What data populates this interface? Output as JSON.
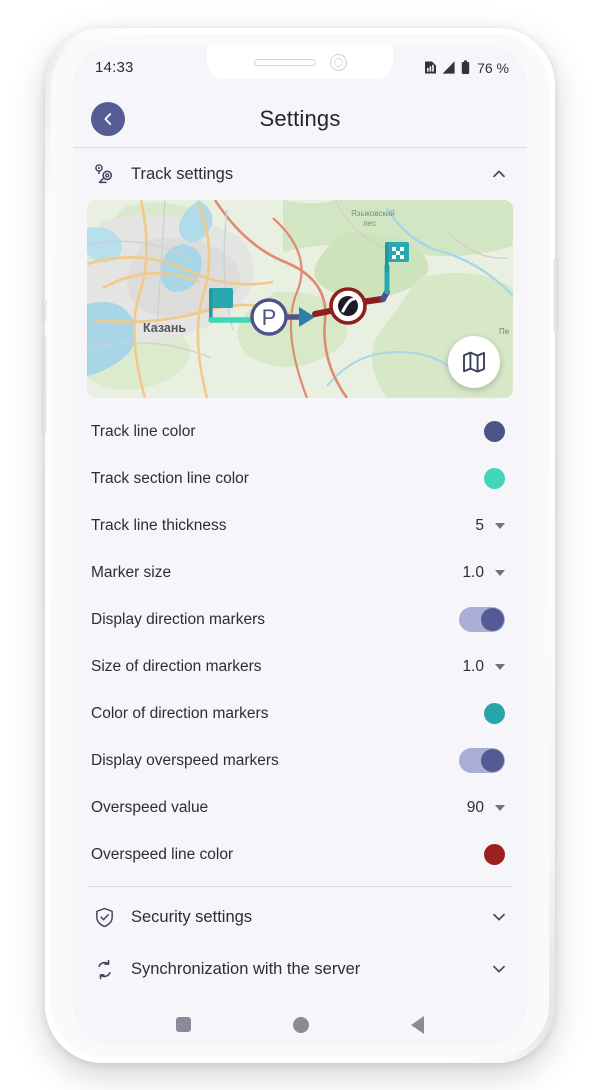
{
  "status_bar": {
    "time": "14:33",
    "battery_text": "76 %",
    "icons": [
      "sim-signal-icon",
      "cellular-signal-icon",
      "battery-icon"
    ]
  },
  "header": {
    "title": "Settings",
    "back_icon": "chevron-left-icon"
  },
  "sections": [
    {
      "id": "track-settings",
      "label": "Track settings",
      "icon": "route-pins-icon",
      "expanded": true,
      "chevron": "chevron-up-icon"
    },
    {
      "id": "security-settings",
      "label": "Security settings",
      "icon": "shield-check-icon",
      "expanded": false,
      "chevron": "chevron-down-icon"
    },
    {
      "id": "synchronization",
      "label": "Synchronization with the server",
      "icon": "sync-arrows-icon",
      "expanded": false,
      "chevron": "chevron-down-icon"
    }
  ],
  "map_preview": {
    "city_label": "Казань",
    "forest_label": "Языковский лес",
    "edge_label": "Пе",
    "start_marker": "flag-start-marker",
    "parking_marker": "parking-marker",
    "speed_marker": "speedometer-marker",
    "finish_marker": "checkered-flag-marker",
    "fab_icon": "folded-map-icon"
  },
  "track_rows": [
    {
      "label": "Track line color",
      "type": "color",
      "color": "#4e5289"
    },
    {
      "label": "Track section line color",
      "type": "color",
      "color": "#41d6b4"
    },
    {
      "label": "Track line thickness",
      "type": "select",
      "value": "5"
    },
    {
      "label": "Marker size",
      "type": "select",
      "value": "1.0"
    },
    {
      "label": "Display direction markers",
      "type": "toggle",
      "value": "on"
    },
    {
      "label": "Size of direction markers",
      "type": "select",
      "value": "1.0"
    },
    {
      "label": "Color of direction markers",
      "type": "color",
      "color": "#26a6a6"
    },
    {
      "label": "Display overspeed markers",
      "type": "toggle",
      "value": "on"
    },
    {
      "label": "Overspeed value",
      "type": "select",
      "value": "90"
    },
    {
      "label": "Overspeed line color",
      "type": "color",
      "color": "#9c2020"
    }
  ],
  "nav_bar": {
    "recents": "square-recents-icon",
    "home": "circle-home-icon",
    "back": "triangle-back-icon"
  },
  "theme": {
    "screen_bg": "#f6f5fa",
    "accent": "#565d96",
    "toggle_track": "#a9aed4",
    "toggle_knob": "#535a94",
    "text": "#2d2d38",
    "divider": "#dcdbe4"
  }
}
